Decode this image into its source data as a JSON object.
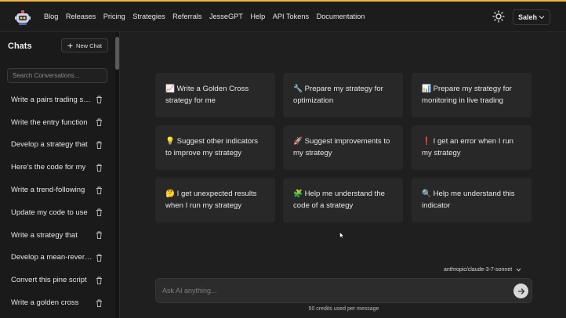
{
  "nav": {
    "links": [
      "Blog",
      "Releases",
      "Pricing",
      "Strategies",
      "Referrals",
      "JesseGPT",
      "Help",
      "API Tokens",
      "Documentation"
    ],
    "user": "Saleh",
    "accent": "#f2b33d"
  },
  "sidebar": {
    "title": "Chats",
    "new_chat": "New Chat",
    "search_placeholder": "Search Conversations...",
    "chats": [
      "Write a pairs trading strategy",
      "Write the entry function",
      "Develop a strategy that",
      "Here's the code for my",
      "Write a trend-following",
      "Update my code to use",
      "Write a strategy that",
      "Develop a mean-reversion",
      "Convert this pine script",
      "Write a golden cross"
    ]
  },
  "suggestions": [
    {
      "icon": "chart-icon",
      "text": "📈 Write a Golden Cross strategy for me"
    },
    {
      "icon": "wrench-icon",
      "text": "🔧 Prepare my strategy for optimization"
    },
    {
      "icon": "bar-chart-icon",
      "text": "📊 Prepare my strategy for monitoring in live trading"
    },
    {
      "icon": "bulb-icon",
      "text": "💡 Suggest other indicators to improve my strategy"
    },
    {
      "icon": "rocket-icon",
      "text": "🚀 Suggest improvements to my strategy"
    },
    {
      "icon": "exclamation-icon",
      "text": "❗ I get an error when I run my strategy"
    },
    {
      "icon": "thinking-icon",
      "text": "🤔 I get unexpected results when I run my strategy"
    },
    {
      "icon": "puzzle-icon",
      "text": "🧩 Help me understand the code of a strategy"
    },
    {
      "icon": "magnifier-icon",
      "text": "🔍 Help me understand this indicator"
    }
  ],
  "composer": {
    "model": "anthropic/claude-3-7-sonnet",
    "placeholder": "Ask AI anything...",
    "credits": "50 credits used per message"
  }
}
